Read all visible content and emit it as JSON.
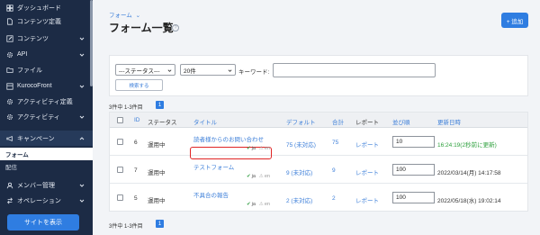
{
  "sidebar": {
    "items": [
      {
        "label": "ダッシュボード",
        "icon": "dashboard-icon"
      },
      {
        "label": "コンテンツ定義",
        "icon": "document-icon"
      },
      {
        "label": "コンテンツ",
        "icon": "edit-icon"
      },
      {
        "label": "API",
        "icon": "gear-icon"
      },
      {
        "label": "ファイル",
        "icon": "folder-icon"
      },
      {
        "label": "KurocoFront",
        "icon": "layout-icon"
      },
      {
        "label": "アクティビティ定義",
        "icon": "gear-icon"
      },
      {
        "label": "アクティビティ",
        "icon": "gear-icon"
      },
      {
        "label": "キャンペーン",
        "icon": "megaphone-icon"
      },
      {
        "label": "メンバー管理",
        "icon": "users-icon"
      },
      {
        "label": "オペレーション",
        "icon": "operation-icon"
      }
    ],
    "sub_items": [
      {
        "label": "フォーム"
      },
      {
        "label": "配信"
      }
    ],
    "view_site_label": "サイトを表示"
  },
  "header": {
    "breadcrumb": "フォーム",
    "title": "フォーム一覧",
    "help": "?",
    "add_label": "+ 追加"
  },
  "filters": {
    "status_value": "---ステータス---",
    "per_page_value": "20件",
    "keyword_label": "キーワード:",
    "keyword_value": "",
    "search_label": "検索する"
  },
  "pagination": {
    "summary_top": "3件中 1-3件目",
    "summary_bottom": "3件中 1-3件目",
    "current_page": "1"
  },
  "table": {
    "columns": [
      "ID",
      "ステータス",
      "タイトル",
      "デフォルト",
      "合計",
      "レポート",
      "並び順",
      "更新日時"
    ],
    "rows": [
      {
        "id": "6",
        "status": "運用中",
        "title": "読者様からのお問い合わせ",
        "default": "75 (未対応)",
        "total": "75",
        "report": "レポート",
        "order": "10",
        "updated": "16:24:19(2秒前に更新)",
        "lang_ja": "ja",
        "lang_en": "en",
        "highlighted": true
      },
      {
        "id": "7",
        "status": "運用中",
        "title": "テストフォーム",
        "default": "9 (未対応)",
        "total": "9",
        "report": "レポート",
        "order": "100",
        "updated": "2022/03/14(月) 14:17:58",
        "lang_ja": "ja",
        "lang_en": "en",
        "highlighted": false
      },
      {
        "id": "5",
        "status": "運用中",
        "title": "不具合の報告",
        "default": "2 (未対応)",
        "total": "2",
        "report": "レポート",
        "order": "100",
        "updated": "2022/05/18(水) 19:02:14",
        "lang_ja": "ja",
        "lang_en": "en",
        "highlighted": false
      }
    ]
  },
  "colors": {
    "sidebar_bg": "#1c2b45",
    "primary": "#2f7de1",
    "link": "#3d7fd9",
    "highlight": "#e02424",
    "recent_update": "#2fa13e"
  }
}
